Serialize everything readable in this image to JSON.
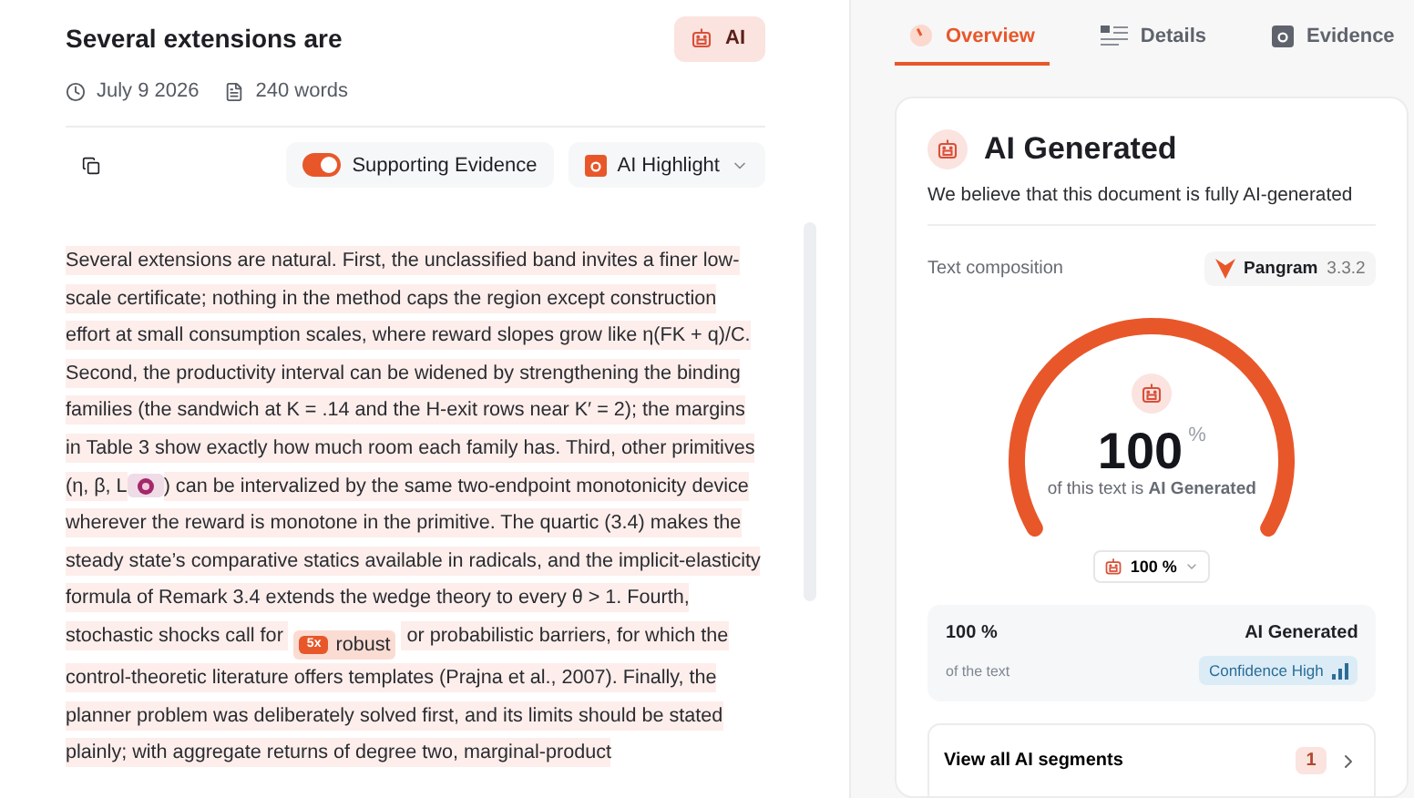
{
  "document": {
    "title": "Several extensions are",
    "badge": "AI",
    "date": "July 9 2026",
    "word_count": "240 words"
  },
  "toolbar": {
    "supporting_evidence": {
      "label": "Supporting Evidence",
      "on": true
    },
    "highlight": {
      "label": "AI Highlight"
    }
  },
  "body": [
    {
      "kind": "text",
      "text": "Several extensions are natural. First, the unclassified band invites a finer low-scale certificate; nothing in the method caps the region except construction effort at small consumption scales, where reward slopes grow like η(FK + q)/C. Second, the productivity interval can be widened by strengthening the binding families (the sandwich at K = .14 and the H-exit rows near K′ = 2); the margins in Table 3 show exactly how much room each family has. Third, other primitives (η, β, L"
    },
    {
      "kind": "chip"
    },
    {
      "kind": "text",
      "text": ") can be intervalized by the same two-endpoint monotonicity device wherever the reward is monotone in the primitive. The quartic (3.4) makes the steady state’s comparative statics available in radicals, and the implicit-elasticity formula of Remark 3.4 extends the wedge theory to every θ > 1. Fourth, stochastic shocks call for "
    },
    {
      "kind": "flag",
      "badge": "5x",
      "text": "robust"
    },
    {
      "kind": "text",
      "text": " or probabilistic barriers, for which the control-theoretic literature offers templates (Prajna et al., 2007). Finally, the planner problem was deliberately solved first, and its limits should be stated plainly; with aggregate returns of degree two, marginal-product"
    }
  ],
  "tabs": [
    {
      "label": "Overview",
      "selected": true
    },
    {
      "label": "Details",
      "selected": false
    },
    {
      "label": "Evidence",
      "selected": false
    }
  ],
  "result": {
    "title": "AI Generated",
    "description": "We believe that this document is fully AI-generated",
    "composition_label": "Text composition",
    "model": {
      "name": "Pangram",
      "version": "3.3.2"
    },
    "gauge": {
      "value": "100",
      "unit": "%",
      "caption_prefix": "of this text is ",
      "caption_bold": "AI Generated"
    },
    "selector": "100 %",
    "stats": {
      "percent": "100 %",
      "percent_caption": "of the text",
      "label": "AI Generated",
      "confidence": "Confidence High"
    },
    "segments": {
      "label": "View all AI segments",
      "count": "1"
    }
  }
}
